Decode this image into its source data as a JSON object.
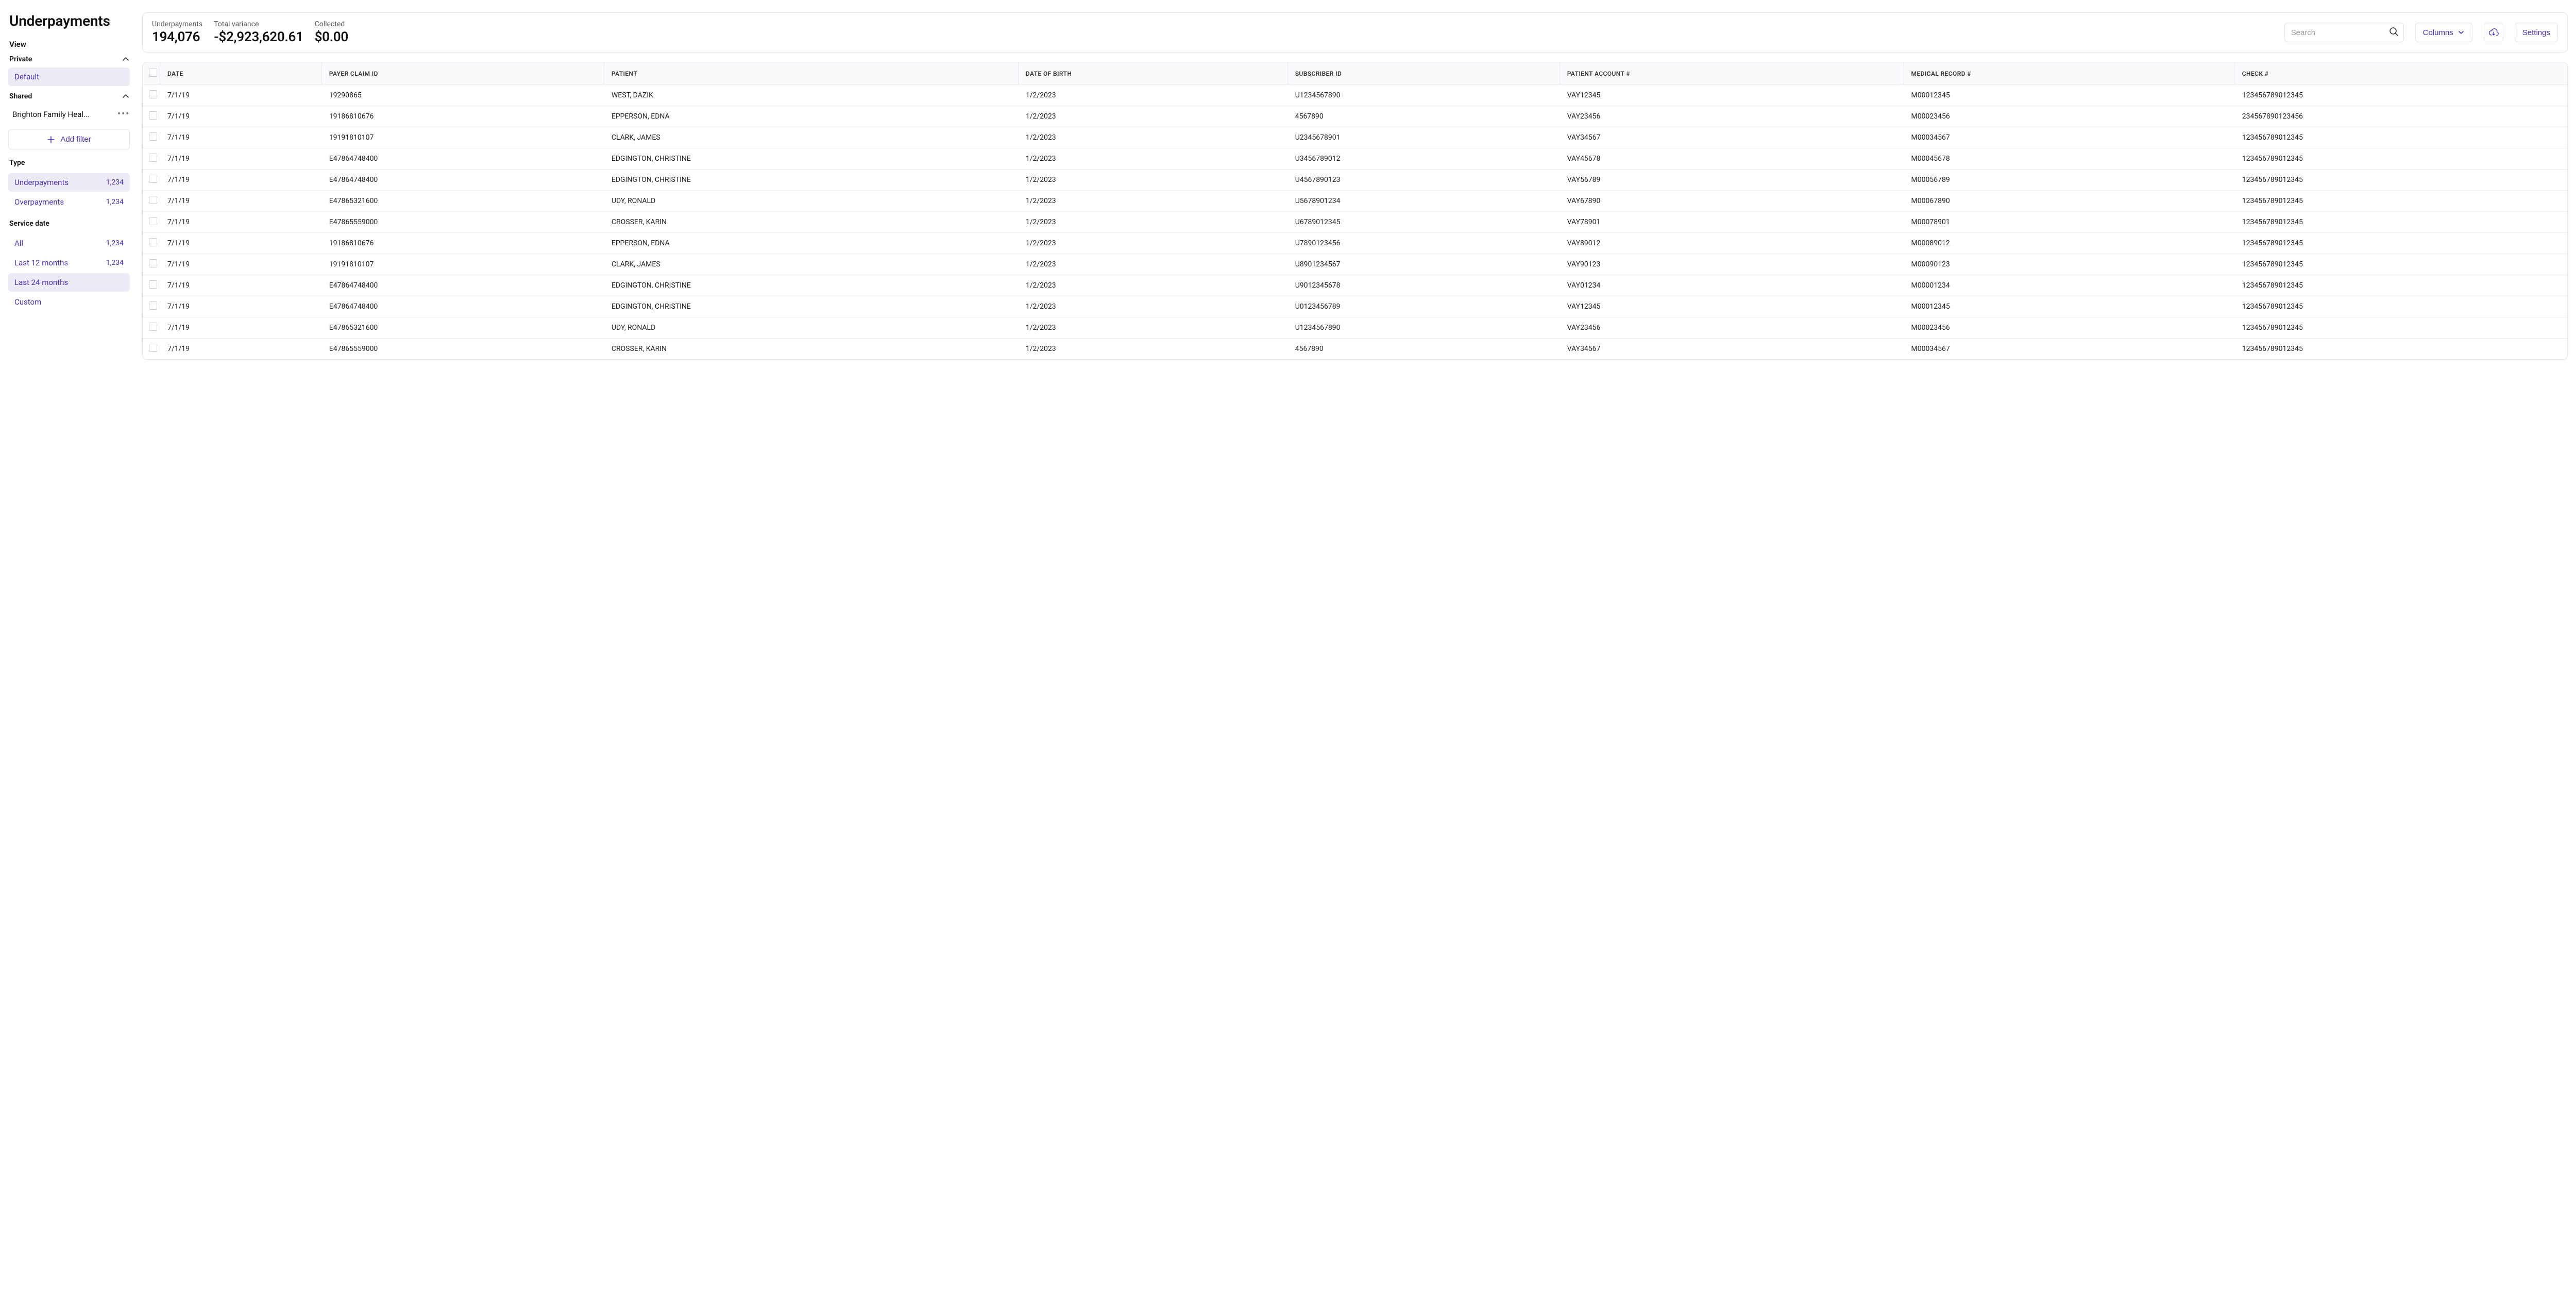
{
  "page_title": "Underpayments",
  "sidebar": {
    "view_label": "View",
    "private_label": "Private",
    "default_label": "Default",
    "shared_label": "Shared",
    "shared_item_label": "Brighton Family Heal...",
    "add_filter_label": "Add filter",
    "type_label": "Type",
    "type_items": [
      {
        "label": "Underpayments",
        "count": "1,234",
        "selected": true
      },
      {
        "label": "Overpayments",
        "count": "1,234",
        "selected": false
      }
    ],
    "service_date_label": "Service date",
    "service_date_items": [
      {
        "label": "All",
        "count": "1,234",
        "selected": false
      },
      {
        "label": "Last 12 months",
        "count": "1,234",
        "selected": false
      },
      {
        "label": "Last 24 months",
        "count": "",
        "selected": true
      },
      {
        "label": "Custom",
        "count": "",
        "selected": false
      }
    ]
  },
  "stats": {
    "underpayments_label": "Underpayments",
    "underpayments_value": "194,076",
    "variance_label": "Total variance",
    "variance_value": "-$2,923,620.61",
    "collected_label": "Collected",
    "collected_value": "$0.00"
  },
  "toolbar": {
    "search_placeholder": "Search",
    "columns_label": "Columns",
    "settings_label": "Settings"
  },
  "table": {
    "columns": [
      "DATE",
      "PAYER CLAIM ID",
      "PATIENT",
      "DATE OF BIRTH",
      "SUBSCRIBER ID",
      "PATIENT ACCOUNT #",
      "MEDICAL RECORD #",
      "CHECK #"
    ],
    "rows": [
      [
        "7/1/19",
        "19290865",
        "WEST, DAZIK",
        "1/2/2023",
        "U1234567890",
        "VAY12345",
        "M00012345",
        "123456789012345"
      ],
      [
        "7/1/19",
        "19186810676",
        "EPPERSON, EDNA",
        "1/2/2023",
        "4567890",
        "VAY23456",
        "M00023456",
        "234567890123456"
      ],
      [
        "7/1/19",
        "19191810107",
        "CLARK, JAMES",
        "1/2/2023",
        "U2345678901",
        "VAY34567",
        "M00034567",
        "123456789012345"
      ],
      [
        "7/1/19",
        "E47864748400",
        "EDGINGTON, CHRISTINE",
        "1/2/2023",
        "U3456789012",
        "VAY45678",
        "M00045678",
        "123456789012345"
      ],
      [
        "7/1/19",
        "E47864748400",
        "EDGINGTON, CHRISTINE",
        "1/2/2023",
        "U4567890123",
        "VAY56789",
        "M00056789",
        "123456789012345"
      ],
      [
        "7/1/19",
        "E47865321600",
        "UDY, RONALD",
        "1/2/2023",
        "U5678901234",
        "VAY67890",
        "M00067890",
        "123456789012345"
      ],
      [
        "7/1/19",
        "E47865559000",
        "CROSSER, KARIN",
        "1/2/2023",
        "U6789012345",
        "VAY78901",
        "M00078901",
        "123456789012345"
      ],
      [
        "7/1/19",
        "19186810676",
        "EPPERSON, EDNA",
        "1/2/2023",
        "U7890123456",
        "VAY89012",
        "M00089012",
        "123456789012345"
      ],
      [
        "7/1/19",
        "19191810107",
        "CLARK, JAMES",
        "1/2/2023",
        "U8901234567",
        "VAY90123",
        "M00090123",
        "123456789012345"
      ],
      [
        "7/1/19",
        "E47864748400",
        "EDGINGTON, CHRISTINE",
        "1/2/2023",
        "U9012345678",
        "VAY01234",
        "M00001234",
        "123456789012345"
      ],
      [
        "7/1/19",
        "E47864748400",
        "EDGINGTON, CHRISTINE",
        "1/2/2023",
        "U0123456789",
        "VAY12345",
        "M00012345",
        "123456789012345"
      ],
      [
        "7/1/19",
        "E47865321600",
        "UDY, RONALD",
        "1/2/2023",
        "U1234567890",
        "VAY23456",
        "M00023456",
        "123456789012345"
      ],
      [
        "7/1/19",
        "E47865559000",
        "CROSSER, KARIN",
        "1/2/2023",
        "4567890",
        "VAY34567",
        "M00034567",
        "123456789012345"
      ]
    ]
  }
}
